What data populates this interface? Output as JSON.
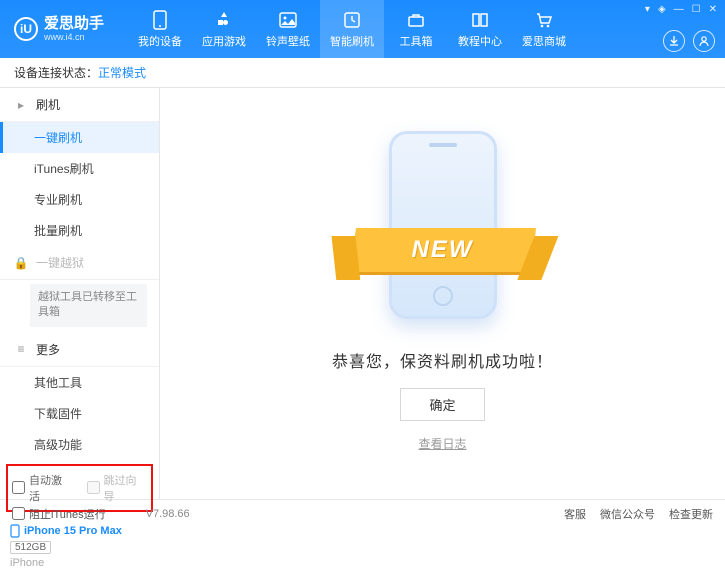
{
  "brand": {
    "name": "爱思助手",
    "url": "www.i4.cn",
    "logo_letter": "iU"
  },
  "nav": [
    {
      "label": "我的设备"
    },
    {
      "label": "应用游戏"
    },
    {
      "label": "铃声壁纸"
    },
    {
      "label": "智能刷机"
    },
    {
      "label": "工具箱"
    },
    {
      "label": "教程中心"
    },
    {
      "label": "爱思商城"
    }
  ],
  "status": {
    "prefix": "设备连接状态：",
    "mode": "正常模式"
  },
  "sidebar": {
    "group_flash": "刷机",
    "items_flash": [
      "一键刷机",
      "iTunes刷机",
      "专业刷机",
      "批量刷机"
    ],
    "group_jailbreak": "一键越狱",
    "jailbreak_note": "越狱工具已转移至工具箱",
    "group_more": "更多",
    "items_more": [
      "其他工具",
      "下载固件",
      "高级功能"
    ],
    "check_auto": "自动激活",
    "check_skip": "跳过向导"
  },
  "device": {
    "name": "iPhone 15 Pro Max",
    "storage": "512GB",
    "type": "iPhone"
  },
  "main": {
    "ribbon": "NEW",
    "message": "恭喜您，保资料刷机成功啦！",
    "ok": "确定",
    "view_log": "查看日志"
  },
  "footer": {
    "block_itunes": "阻止iTunes运行",
    "version": "V7.98.66",
    "links": [
      "客服",
      "微信公众号",
      "检查更新"
    ]
  }
}
